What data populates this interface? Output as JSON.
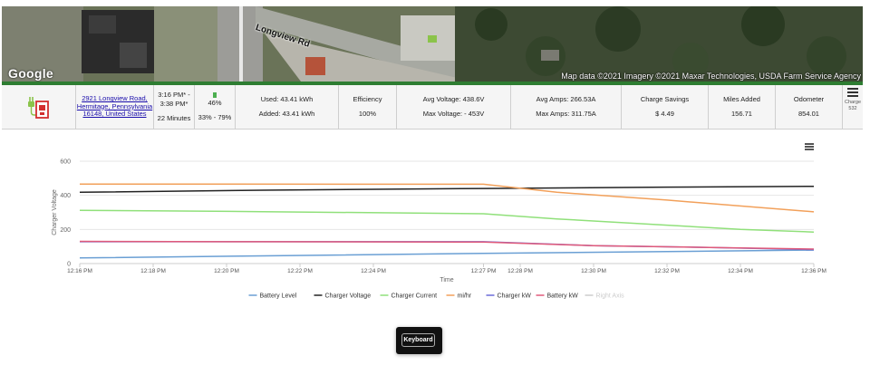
{
  "map": {
    "logo": "Google",
    "road_label": "Longview Rd",
    "attribution": "Map data ©2021 Imagery ©2021 Maxar Technologies, USDA Farm Service Agency"
  },
  "summary": {
    "address": [
      "2921 Longview Road,",
      "Hermitage, Pennsylvania",
      "16148, United States"
    ],
    "time_start": "3:16 PM* -",
    "time_end": "3:38 PM*",
    "duration": "22 Minutes",
    "battery_pct": "46%",
    "battery_range": "33% - 79%",
    "used": "Used: 43.41 kWh",
    "added": "Added: 43.41 kWh",
    "efficiency_label": "Efficiency",
    "efficiency_value": "100%",
    "avg_voltage": "Avg Voltage: 438.6V",
    "max_voltage": "Max Voltage: - 453V",
    "avg_amps": "Avg Amps: 266.53A",
    "max_amps": "Max Amps: 311.75A",
    "savings_label": "Charge Savings",
    "savings_value": "$ 4.49",
    "miles_label": "Miles Added",
    "miles_value": "156.71",
    "odometer_label": "Odometer",
    "odometer_value": "854.01",
    "charge_label": "Charge",
    "charge_id": "532",
    "colors": {
      "accent_green": "#2e7d32",
      "charger_icon_red": "#d32f2f"
    }
  },
  "chart_data": {
    "type": "line",
    "ylabel": "Charger Voltage",
    "xlabel": "Time",
    "ylim": [
      0,
      600
    ],
    "yticks": [
      0,
      200,
      400,
      600
    ],
    "xlim": [
      0,
      20
    ],
    "x_ticks": [
      {
        "x": 0,
        "label": "12:16 PM"
      },
      {
        "x": 2,
        "label": "12:18 PM"
      },
      {
        "x": 4,
        "label": "12:20 PM"
      },
      {
        "x": 6,
        "label": "12:22 PM"
      },
      {
        "x": 8,
        "label": "12:24 PM"
      },
      {
        "x": 11,
        "label": "12:27 PM"
      },
      {
        "x": 12,
        "label": "12:28 PM"
      },
      {
        "x": 14,
        "label": "12:30 PM"
      },
      {
        "x": 16,
        "label": "12:32 PM"
      },
      {
        "x": 18,
        "label": "12:34 PM"
      },
      {
        "x": 20,
        "label": "12:36 PM"
      }
    ],
    "grid": true,
    "legend_position": "bottom",
    "series": [
      {
        "name": "Battery Level",
        "color": "#6a9fd4",
        "visible": true,
        "points": [
          [
            0,
            33
          ],
          [
            5,
            45
          ],
          [
            11,
            60
          ],
          [
            16,
            70
          ],
          [
            20,
            79
          ]
        ]
      },
      {
        "name": "Charger Voltage",
        "color": "#222222",
        "visible": true,
        "points": [
          [
            0,
            418
          ],
          [
            5,
            430
          ],
          [
            11,
            440
          ],
          [
            16,
            448
          ],
          [
            20,
            453
          ]
        ]
      },
      {
        "name": "Charger Current",
        "color": "#90e07a",
        "visible": true,
        "points": [
          [
            0,
            312
          ],
          [
            5,
            304
          ],
          [
            11,
            292
          ],
          [
            13,
            262
          ],
          [
            16,
            225
          ],
          [
            18,
            200
          ],
          [
            20,
            185
          ]
        ]
      },
      {
        "name": "mi/hr",
        "color": "#f2a05a",
        "visible": true,
        "points": [
          [
            0,
            466
          ],
          [
            11,
            465
          ],
          [
            13,
            418
          ],
          [
            16,
            372
          ],
          [
            20,
            303
          ]
        ]
      },
      {
        "name": "Charger kW",
        "color": "#6b6bd8",
        "visible": true,
        "points": [
          [
            0,
            128
          ],
          [
            5,
            128
          ],
          [
            11,
            128
          ],
          [
            14,
            105
          ],
          [
            17,
            95
          ],
          [
            20,
            82
          ]
        ]
      },
      {
        "name": "Battery kW",
        "color": "#e05a7a",
        "visible": true,
        "points": [
          [
            0,
            130
          ],
          [
            5,
            128
          ],
          [
            11,
            126
          ],
          [
            14,
            105
          ],
          [
            17,
            95
          ],
          [
            20,
            85
          ]
        ]
      },
      {
        "name": "Right Axis",
        "color": "#cccccc",
        "visible": false,
        "points": []
      }
    ]
  },
  "chart_menu_icon": "hamburger-icon",
  "keyboard_button": {
    "label": "Keyboard"
  }
}
